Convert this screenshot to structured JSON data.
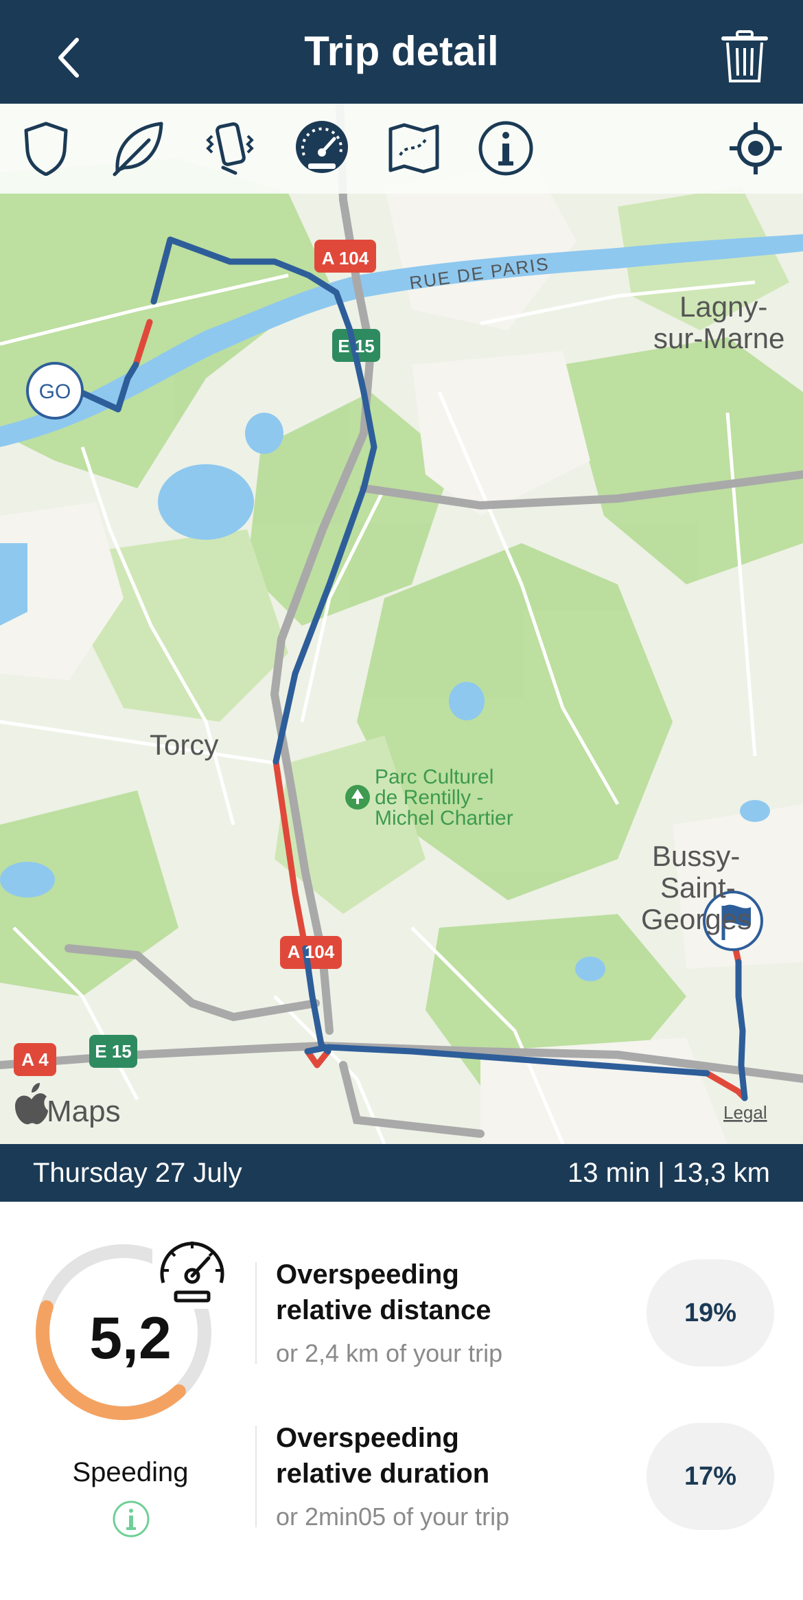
{
  "header": {
    "title": "Trip detail"
  },
  "map": {
    "labels": {
      "a104_top": "A 104",
      "e15_top": "E 15",
      "rue_de_paris": "RUE DE PARIS",
      "lagny_1": "Lagny-",
      "lagny_2": "sur-Marne",
      "torcy": "Torcy",
      "parc_1": "Parc Culturel",
      "parc_2": "de Rentilly -",
      "parc_3": "Michel Chartier",
      "bussy_1": "Bussy-",
      "bussy_2": "Saint-",
      "bussy_3": "Georges",
      "a104_bottom": "A 104",
      "a4": "A 4",
      "e15_bottom": "E 15",
      "go": "GO",
      "maps_brand": "Maps",
      "legal": "Legal"
    }
  },
  "trip": {
    "date": "Thursday 27 July",
    "summary": "13 min | 13,3 km"
  },
  "score": {
    "value": "5,2",
    "label": "Speeding",
    "fill_fraction": 0.42
  },
  "metrics": [
    {
      "title_line1": "Overspeeding",
      "title_line2": "relative distance",
      "sub": "or 2,4 km of your trip",
      "value": "19%"
    },
    {
      "title_line1": "Overspeeding",
      "title_line2": "relative duration",
      "sub": "or 2min05 of your trip",
      "value": "17%"
    }
  ],
  "colors": {
    "header": "#1b3a55",
    "route": "#2e5e99",
    "overspeed": "#e0493a",
    "gauge_fill": "#f4a261",
    "gauge_track": "#e3e3e3",
    "info_icon": "#6fcf97"
  }
}
